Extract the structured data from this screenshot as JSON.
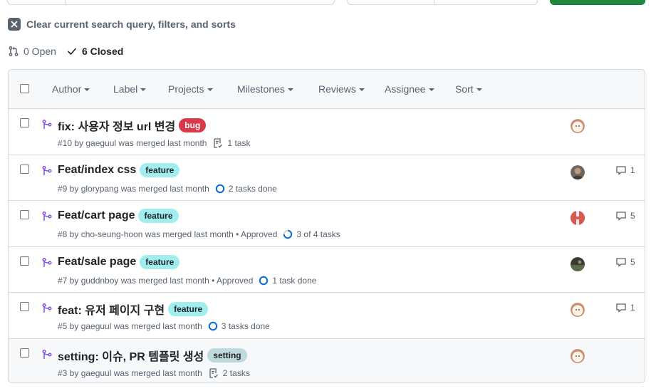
{
  "search_bar": {},
  "clear_filters": {
    "label": "Clear current search query, filters, and sorts"
  },
  "state_tabs": {
    "open": "0 Open",
    "closed": "6 Closed"
  },
  "filters": [
    "Author",
    "Label",
    "Projects",
    "Milestones",
    "Reviews",
    "Assignee",
    "Sort"
  ],
  "colors": {
    "merged_purple": "#8250df",
    "bug_label": "#d73a4a",
    "feature_label": "#a2eeef",
    "setting_label": "#bfdadc",
    "green_button": "#1f883d"
  },
  "pulls": [
    {
      "title": "fix: 사용자 정보 url 변경",
      "label": "bug",
      "meta": "#10 by gaeguul was merged last month",
      "task_icon": "checklist-icon",
      "task_text": "1 task",
      "comments": null,
      "avatar": "avatar-gaeguul"
    },
    {
      "title": "Feat/index css",
      "label": "feature",
      "meta": "#9 by glorypang was merged last month",
      "task_icon": "progress-circle-icon",
      "task_text": "2 tasks done",
      "comments": "1",
      "avatar": "avatar-glorypang"
    },
    {
      "title": "Feat/cart page",
      "label": "feature",
      "meta": "#8 by cho-seung-hoon was merged last month • Approved",
      "task_icon": "partial-progress-circle-icon",
      "task_text": "3 of 4 tasks",
      "comments": "5",
      "avatar": "avatar-cho-seung-hoon"
    },
    {
      "title": "Feat/sale page",
      "label": "feature",
      "meta": "#7 by guddnboy was merged last month • Approved",
      "task_icon": "progress-circle-icon",
      "task_text": "1 task done",
      "comments": "5",
      "avatar": "avatar-guddnboy"
    },
    {
      "title": "feat: 유저 페이지 구현",
      "label": "feature",
      "meta": "#5 by gaeguul was merged last month",
      "task_icon": "progress-circle-icon",
      "task_text": "3 tasks done",
      "comments": "1",
      "avatar": "avatar-gaeguul"
    },
    {
      "title": "setting: 이슈, PR 템플릿 생성",
      "label": "setting",
      "meta": "#3 by gaeguul was merged last month",
      "task_icon": "checklist-icon",
      "task_text": "2 tasks",
      "comments": null,
      "avatar": "avatar-gaeguul"
    }
  ]
}
